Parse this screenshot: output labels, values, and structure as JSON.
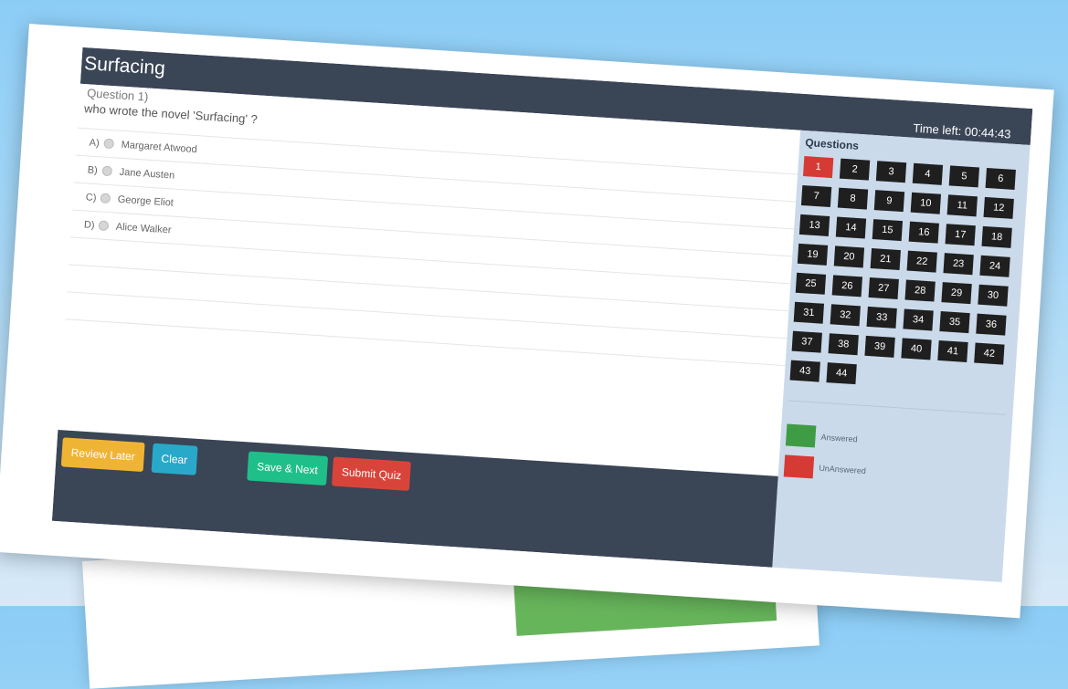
{
  "app": {
    "title": "Surfacing",
    "timer": "Time left: 00:44:43"
  },
  "question": {
    "label": "Question 1)",
    "text": "who wrote the novel 'Surfacing' ?",
    "options": [
      {
        "letter": "A)",
        "text": "Margaret Atwood"
      },
      {
        "letter": "B)",
        "text": "Jane Austen"
      },
      {
        "letter": "C)",
        "text": "George Eliot"
      },
      {
        "letter": "D)",
        "text": "Alice Walker"
      }
    ]
  },
  "sidebar": {
    "title": "Questions",
    "current": 1,
    "numbers": [
      "1",
      "2",
      "3",
      "4",
      "5",
      "6",
      "7",
      "8",
      "9",
      "10",
      "11",
      "12",
      "13",
      "14",
      "15",
      "16",
      "17",
      "18",
      "19",
      "20",
      "21",
      "22",
      "23",
      "24",
      "25",
      "26",
      "27",
      "28",
      "29",
      "30",
      "31",
      "32",
      "33",
      "34",
      "35",
      "36",
      "37",
      "38",
      "39",
      "40",
      "41",
      "42",
      "43",
      "44"
    ],
    "legend": [
      {
        "label": "Answered",
        "color": "#3e9c45"
      },
      {
        "label": "UnAnswered",
        "color": "#d63a34"
      }
    ]
  },
  "footer": {
    "review_label": "Review Later",
    "clear_label": "Clear",
    "save_label": "Save & Next",
    "submit_label": "Submit Quiz"
  },
  "colors": {
    "header": "#3a4556",
    "sidebar": "#cbdaea",
    "current_question": "#d63a34",
    "question_button": "#1f1f1f"
  }
}
